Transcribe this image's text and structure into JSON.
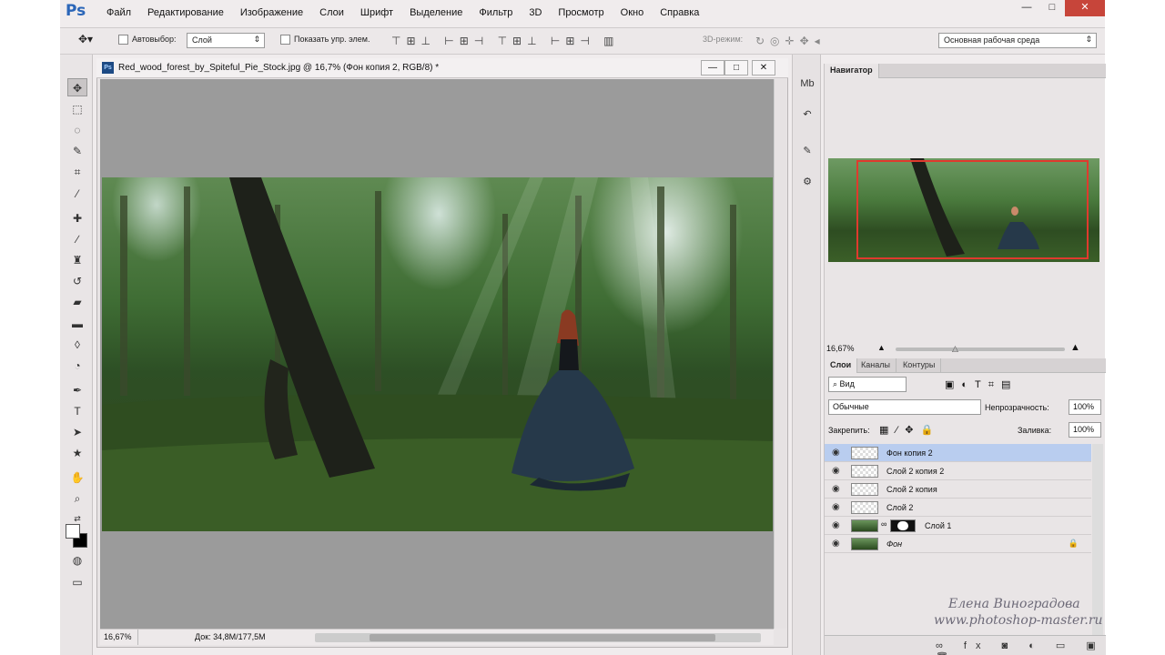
{
  "app": {
    "logo": "Ps"
  },
  "menu": [
    "Файл",
    "Редактирование",
    "Изображение",
    "Слои",
    "Шрифт",
    "Выделение",
    "Фильтр",
    "3D",
    "Просмотр",
    "Окно",
    "Справка"
  ],
  "window_controls": {
    "minimize": "—",
    "maximize": "□",
    "close": "✕"
  },
  "options": {
    "autoselect_label": "Автовыбор:",
    "autoselect_value": "Слой",
    "show_controls_label": "Показать упр. элем.",
    "mode3d_label": "3D-режим:",
    "workspace": "Основная рабочая среда"
  },
  "document": {
    "title": "Red_wood_forest_by_Spiteful_Pie_Stock.jpg @ 16,7% (Фон копия 2, RGB/8) *",
    "zoom": "16,67%",
    "doc_size": "Док: 34,8M/177,5M"
  },
  "navigator": {
    "tab": "Навигатор",
    "zoom": "16,67%"
  },
  "layers_panel": {
    "tabs": [
      "Слои",
      "Каналы",
      "Контуры"
    ],
    "filter_kind": "Вид",
    "blend_mode": "Обычные",
    "opacity_label": "Непрозрачность:",
    "opacity_value": "100%",
    "lock_label": "Закрепить:",
    "fill_label": "Заливка:",
    "fill_value": "100%",
    "layers": [
      {
        "name": "Фон копия 2",
        "selected": true
      },
      {
        "name": "Слой 2 копия 2",
        "selected": false
      },
      {
        "name": "Слой 2 копия",
        "selected": false
      },
      {
        "name": "Слой 2",
        "selected": false
      },
      {
        "name": "Слой 1",
        "selected": false
      },
      {
        "name": "Фон",
        "selected": false
      }
    ]
  },
  "watermark": {
    "author": "Елена Виноградова",
    "site": "www.photoshop-master.ru"
  },
  "colors": {
    "accent": "#2b66b8",
    "selection": "#b9cdef",
    "nav_rect": "#e03a2e"
  }
}
